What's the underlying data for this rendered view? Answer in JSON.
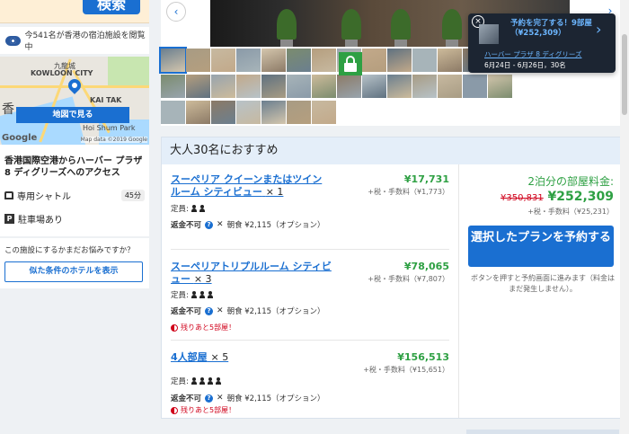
{
  "search": {
    "button_label": "検索"
  },
  "viewing_text": "今541名が香港の宿泊施設を閲覧中",
  "map": {
    "labels": [
      "KOWLOON CITY",
      "九龍城",
      "KAI TAK",
      "香",
      "Hoi Shum Park"
    ],
    "button_label": "地図で見る",
    "google": "Google",
    "copyright": "Map data ©2019 Google"
  },
  "access": {
    "title": "香港国際空港からハーバー プラザ 8 ディグリーズへのアクセス",
    "shuttle_label": "専用シャトル",
    "shuttle_time": "45分",
    "parking_label": "駐車場あり"
  },
  "help": {
    "question": "この施設にするかまだお悩みですか？",
    "button_label": "似た条件のホテルを表示"
  },
  "gallery": {
    "prev": "‹",
    "next": "›"
  },
  "toast": {
    "close": "×",
    "title": "予約を完了する！9部屋（¥252,309）",
    "hotel": "ハーバー プラザ 8 ディグリーズ",
    "dates": "6月24日 - 6月26日，30名"
  },
  "recommendation": {
    "heading": "大人30名におすすめ",
    "rooms": [
      {
        "name": "スーペリア クイーンまたはツイン ルーム シティビュー",
        "qty": "× 1",
        "price": "¥17,731",
        "tax": "+税・手数料（¥1,773）",
        "cap_label": "定員:",
        "persons": 2,
        "refund": "返金不可",
        "meal": "朝食 ¥2,115（オプション）",
        "remaining": ""
      },
      {
        "name": "スーペリアトリプルルーム シティビュー",
        "qty": "× 3",
        "price": "¥78,065",
        "tax": "+税・手数料（¥7,807）",
        "cap_label": "定員:",
        "persons": 3,
        "refund": "返金不可",
        "meal": "朝食 ¥2,115（オプション）",
        "remaining": "残りあと5部屋！"
      },
      {
        "name": "4人部屋",
        "qty": "× 5",
        "price": "¥156,513",
        "tax": "+税・手数料（¥15,651）",
        "cap_label": "定員:",
        "persons": 4,
        "refund": "返金不可",
        "meal": "朝食 ¥2,115（オプション）",
        "remaining": "残りあと5部屋！"
      }
    ],
    "summary": {
      "title": "2泊分の部屋料金:",
      "old_price": "¥350,831",
      "new_price": "¥252,309",
      "tax": "+税・手数料（¥25,231）",
      "button_label": "選択したプランを予約する",
      "note": "ボタンを押すと予約画面に進みます（料金はまだ発生しません）。"
    }
  }
}
